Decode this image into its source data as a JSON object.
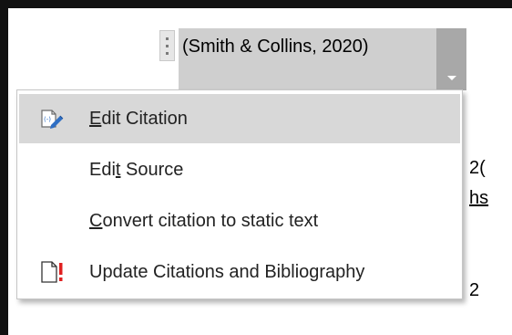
{
  "citation_control": {
    "text": "(Smith & Collins, 2020)"
  },
  "context_menu": {
    "items": [
      {
        "name": "edit-citation",
        "label_before": "",
        "access_key": "E",
        "label_after": "dit Citation",
        "icon": "edit-citation-icon",
        "highlighted": true
      },
      {
        "name": "edit-source",
        "label_before": "Edi",
        "access_key": "t",
        "label_after": " Source",
        "icon": null,
        "highlighted": false
      },
      {
        "name": "convert-to-static-text",
        "label_before": "",
        "access_key": "C",
        "label_after": "onvert citation to static text",
        "icon": null,
        "highlighted": false
      },
      {
        "name": "update-citations-bibliography",
        "label_before": "",
        "access_key": "",
        "label_after": "Update Citations and Bibliography",
        "icon": "update-document-icon",
        "highlighted": false
      }
    ]
  },
  "background_fragments": {
    "line1": "2(",
    "line2": "hs",
    "line3": "2"
  },
  "colors": {
    "frame": "#111111",
    "control_fill": "#cfcfcf",
    "dropdown_fill": "#a8a8a8",
    "menu_highlight": "#d8d8d8",
    "icon_blue": "#2f6fc4",
    "alert_red": "#e02020"
  }
}
